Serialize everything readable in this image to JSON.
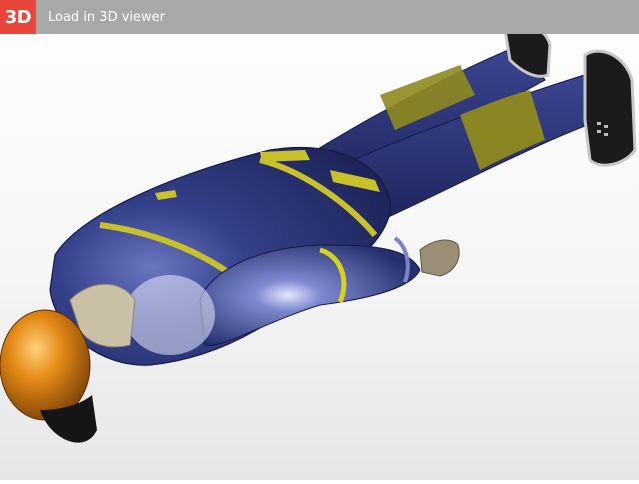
{
  "toolbar": {
    "badge_label": "3D",
    "load_label": "Load in 3D viewer"
  },
  "viewport": {
    "subject": "figure-in-coverall-lying-prone",
    "colors": {
      "toolbar_bg": "#a8a8a8",
      "badge_bg": "#e8463b",
      "suit": "#2b3470",
      "stripe": "#c9c12a",
      "knee_patch": "#8f8a1e",
      "helmet": "#e08a1a",
      "boots": "#1a1a1a"
    }
  }
}
